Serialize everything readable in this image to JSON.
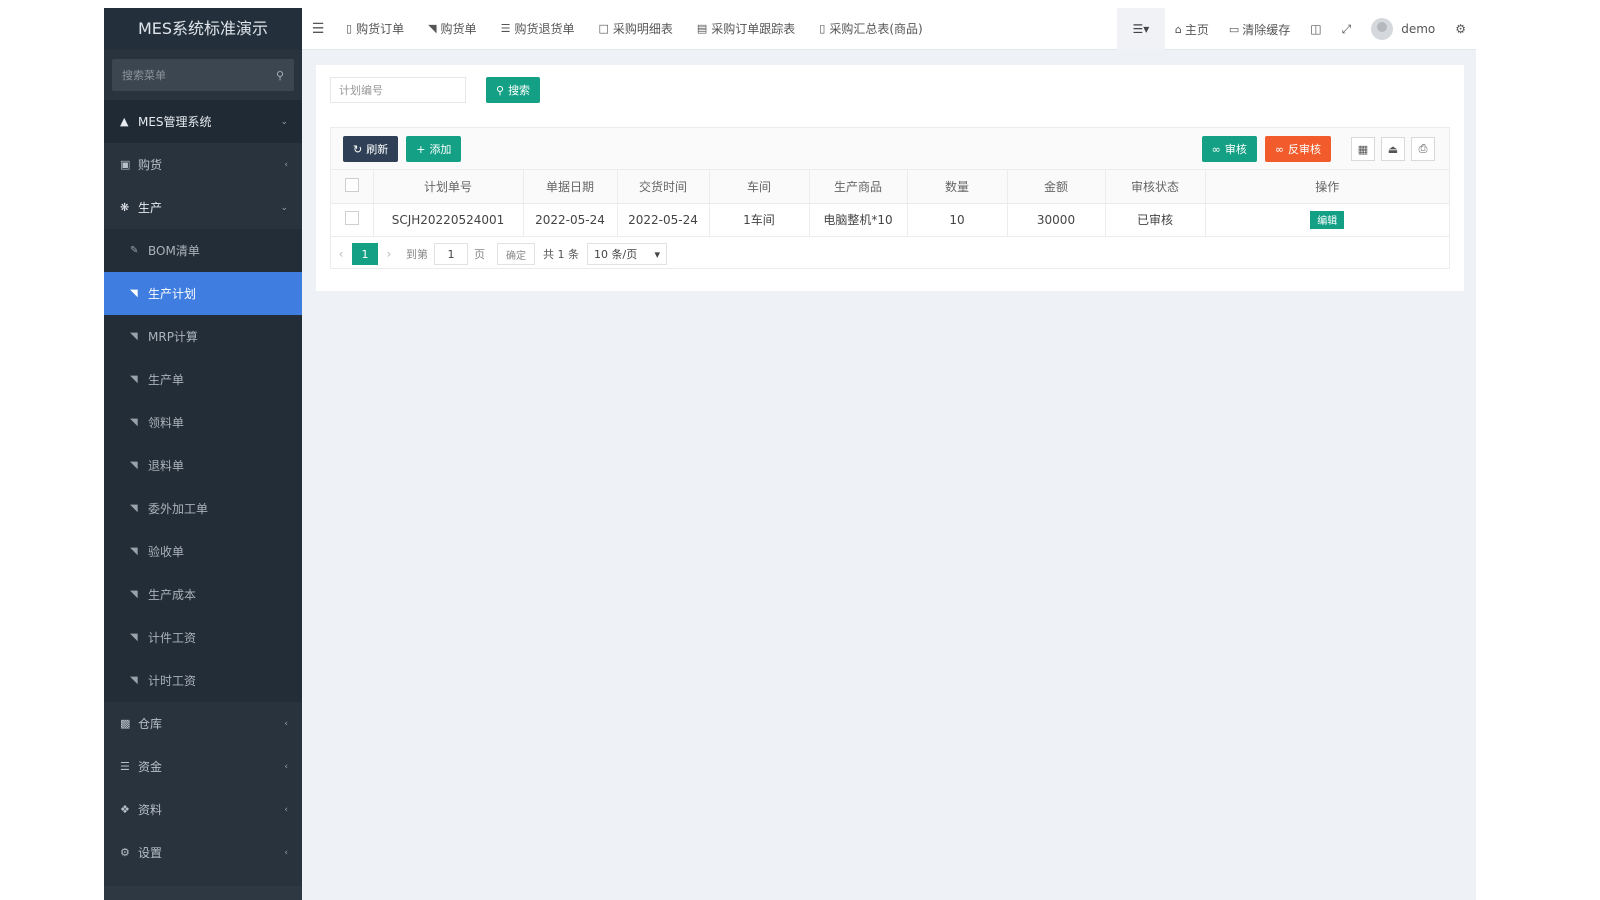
{
  "app": {
    "title": "MES系统标准演示"
  },
  "sidebar": {
    "search_placeholder": "搜索菜单",
    "root": {
      "label": "MES管理系统"
    },
    "groups": [
      {
        "label": "购货"
      },
      {
        "label": "生产"
      },
      {
        "label": "仓库"
      },
      {
        "label": "资金"
      },
      {
        "label": "资料"
      },
      {
        "label": "设置"
      }
    ],
    "production_items": [
      {
        "label": "BOM清单"
      },
      {
        "label": "生产计划"
      },
      {
        "label": "MRP计算"
      },
      {
        "label": "生产单"
      },
      {
        "label": "领料单"
      },
      {
        "label": "退料单"
      },
      {
        "label": "委外加工单"
      },
      {
        "label": "验收单"
      },
      {
        "label": "生产成本"
      },
      {
        "label": "计件工资"
      },
      {
        "label": "计时工资"
      }
    ],
    "active_item": "生产计划"
  },
  "topbar": {
    "tabs": [
      {
        "label": "购货订单",
        "icon": "bar-chart-icon"
      },
      {
        "label": "购货单",
        "icon": "area-chart-icon"
      },
      {
        "label": "购货退货单",
        "icon": "database-icon"
      },
      {
        "label": "采购明细表",
        "icon": "file-icon"
      },
      {
        "label": "采购订单跟踪表",
        "icon": "file-text-icon"
      },
      {
        "label": "采购汇总表(商品)",
        "icon": "bar-chart-icon"
      }
    ],
    "home_label": "主页",
    "clear_cache_label": "清除缓存",
    "user_name": "demo"
  },
  "search": {
    "placeholder": "计划编号",
    "button_label": "搜索"
  },
  "toolbar": {
    "refresh_label": "刷新",
    "add_label": "添加",
    "audit_label": "审核",
    "unaudit_label": "反审核"
  },
  "table": {
    "columns": [
      "计划单号",
      "单据日期",
      "交货时间",
      "车间",
      "生产商品",
      "数量",
      "金额",
      "审核状态",
      "操作"
    ],
    "rows": [
      {
        "plan_no": "SCJH20220524001",
        "doc_date": "2022-05-24",
        "delivery_date": "2022-05-24",
        "workshop": "1车间",
        "product": "电脑整机*10",
        "qty": "10",
        "amount": "30000",
        "status": "已审核",
        "action_label": "编辑"
      }
    ]
  },
  "pager": {
    "current": "1",
    "goto_label": "到第",
    "page_input": "1",
    "page_unit": "页",
    "ok_label": "确定",
    "total_label": "共 1 条",
    "page_size": "10 条/页"
  },
  "colors": {
    "sidebar_bg": "#28333e",
    "active_blue": "#3f7ee0",
    "primary_green": "#14a085",
    "orange": "#f25c2c",
    "dark_button": "#2f4056"
  }
}
